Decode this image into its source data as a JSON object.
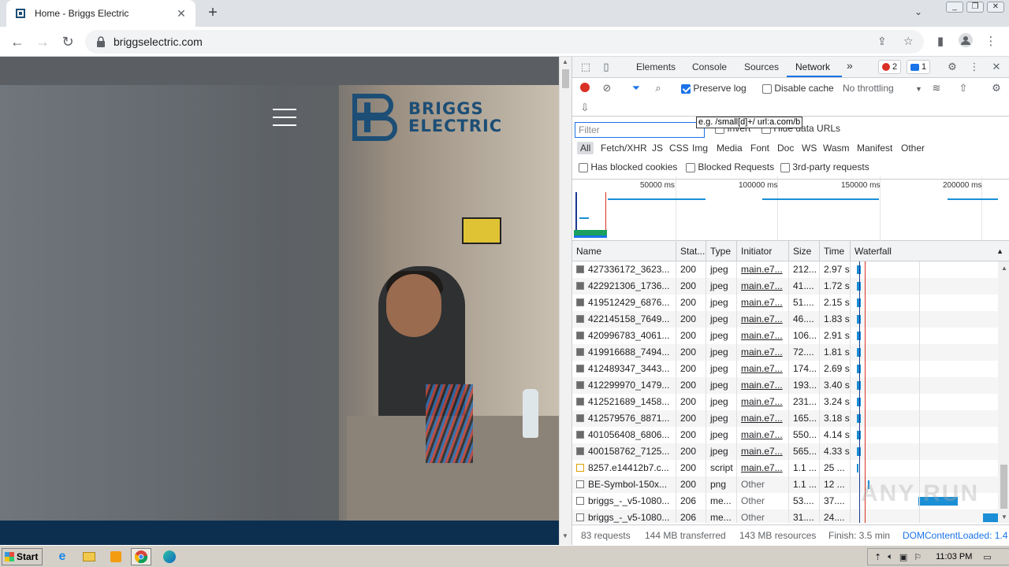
{
  "browser": {
    "tab_title": "Home - Briggs Electric",
    "url": "briggselectric.com",
    "new_tab_symbol": "+",
    "close_symbol": "✕"
  },
  "page": {
    "logo_line1": "BRIGGS",
    "logo_line2": "ELECTRIC",
    "accent_color": "#1d4e75"
  },
  "devtools": {
    "tabs": [
      "Elements",
      "Console",
      "Sources",
      "Network"
    ],
    "active_tab": "Network",
    "more_tabs": "»",
    "error_count": "2",
    "message_count": "1",
    "toolbar": {
      "preserve_log": "Preserve log",
      "disable_cache": "Disable cache",
      "throttling": "No throttling"
    },
    "filter": {
      "placeholder": "Filter",
      "tooltip": "e.g. /small[d]+/ url:a.com/b",
      "invert": "Invert",
      "hide_data_urls": "Hide data URLs",
      "types": [
        "All",
        "Fetch/XHR",
        "JS",
        "CSS",
        "Img",
        "Media",
        "Font",
        "Doc",
        "WS",
        "Wasm",
        "Manifest",
        "Other"
      ],
      "active_type": "All",
      "has_blocked_cookies": "Has blocked cookies",
      "blocked_requests": "Blocked Requests",
      "third_party": "3rd-party requests"
    },
    "overview_ticks": [
      "50000 ms",
      "100000 ms",
      "150000 ms",
      "200000 ms"
    ],
    "columns": [
      "Name",
      "Stat...",
      "Type",
      "Initiator",
      "Size",
      "Time",
      "Waterfall"
    ],
    "rows": [
      {
        "name": "427336172_3623...",
        "status": "200",
        "type": "jpeg",
        "initiator": "main.e7...",
        "size": "212...",
        "time": "2.97 s",
        "icon": "img"
      },
      {
        "name": "422921306_1736...",
        "status": "200",
        "type": "jpeg",
        "initiator": "main.e7...",
        "size": "41....",
        "time": "1.72 s",
        "icon": "img"
      },
      {
        "name": "419512429_6876...",
        "status": "200",
        "type": "jpeg",
        "initiator": "main.e7...",
        "size": "51....",
        "time": "2.15 s",
        "icon": "img"
      },
      {
        "name": "422145158_7649...",
        "status": "200",
        "type": "jpeg",
        "initiator": "main.e7...",
        "size": "46....",
        "time": "1.83 s",
        "icon": "img"
      },
      {
        "name": "420996783_4061...",
        "status": "200",
        "type": "jpeg",
        "initiator": "main.e7...",
        "size": "106...",
        "time": "2.91 s",
        "icon": "img"
      },
      {
        "name": "419916688_7494...",
        "status": "200",
        "type": "jpeg",
        "initiator": "main.e7...",
        "size": "72....",
        "time": "1.81 s",
        "icon": "img"
      },
      {
        "name": "412489347_3443...",
        "status": "200",
        "type": "jpeg",
        "initiator": "main.e7...",
        "size": "174...",
        "time": "2.69 s",
        "icon": "img"
      },
      {
        "name": "412299970_1479...",
        "status": "200",
        "type": "jpeg",
        "initiator": "main.e7...",
        "size": "193...",
        "time": "3.40 s",
        "icon": "img"
      },
      {
        "name": "412521689_1458...",
        "status": "200",
        "type": "jpeg",
        "initiator": "main.e7...",
        "size": "231...",
        "time": "3.24 s",
        "icon": "img"
      },
      {
        "name": "412579576_8871...",
        "status": "200",
        "type": "jpeg",
        "initiator": "main.e7...",
        "size": "165...",
        "time": "3.18 s",
        "icon": "img"
      },
      {
        "name": "401056408_6806...",
        "status": "200",
        "type": "jpeg",
        "initiator": "main.e7...",
        "size": "550...",
        "time": "4.14 s",
        "icon": "img"
      },
      {
        "name": "400158762_7125...",
        "status": "200",
        "type": "jpeg",
        "initiator": "main.e7...",
        "size": "565...",
        "time": "4.33 s",
        "icon": "img"
      },
      {
        "name": "8257.e14412b7.c...",
        "status": "200",
        "type": "script",
        "initiator": "main.e7...",
        "size": "1.1 ...",
        "time": "25 ...",
        "icon": "script"
      },
      {
        "name": "BE-Symbol-150x...",
        "status": "200",
        "type": "png",
        "initiator": "Other",
        "size": "1.1 ...",
        "time": "12 ...",
        "icon": "doc"
      },
      {
        "name": "briggs_-_v5-1080...",
        "status": "206",
        "type": "me...",
        "initiator": "Other",
        "size": "53....",
        "time": "37....",
        "icon": "doc"
      },
      {
        "name": "briggs_-_v5-1080...",
        "status": "206",
        "type": "me...",
        "initiator": "Other",
        "size": "31....",
        "time": "24....",
        "icon": "doc"
      }
    ],
    "status_bar": {
      "requests": "83 requests",
      "transferred": "144 MB transferred",
      "resources": "143 MB resources",
      "finish": "Finish: 3.5 min",
      "dcl": "DOMContentLoaded: 1.4"
    }
  },
  "taskbar": {
    "start": "Start",
    "clock": "11:03 PM"
  },
  "watermark": "ANY RUN"
}
